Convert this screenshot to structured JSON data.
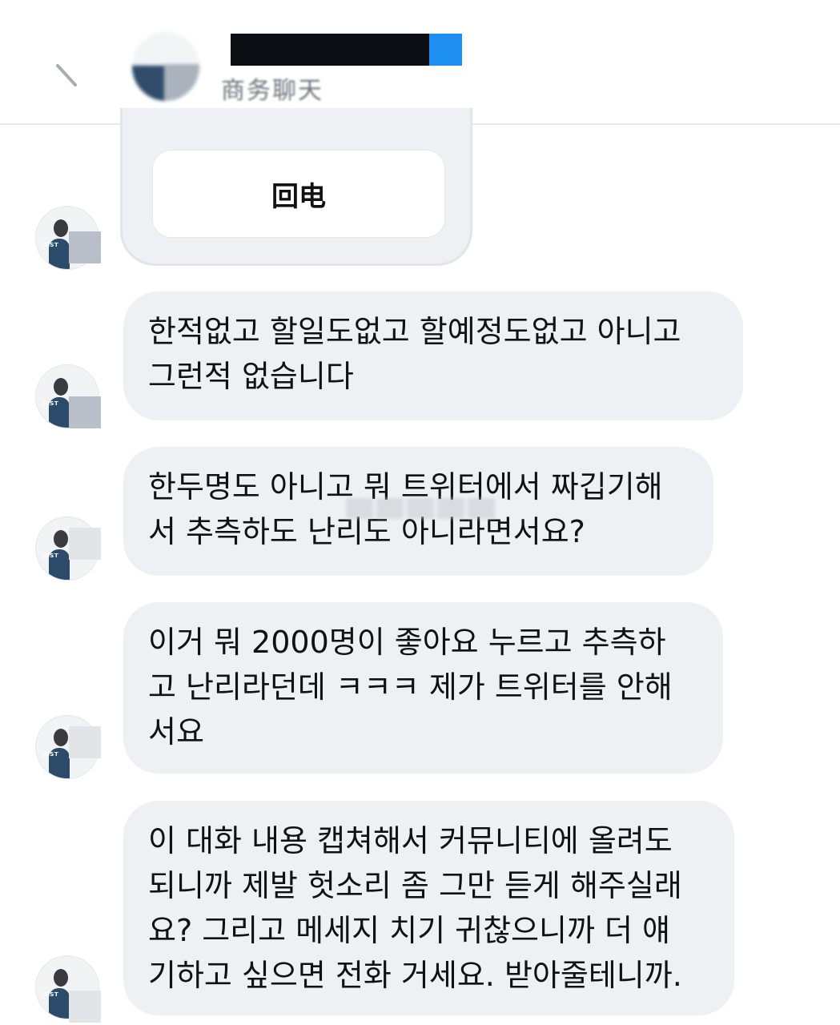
{
  "header": {
    "subtitle": "商务聊天",
    "back_icon": "chevron-left-icon"
  },
  "card": {
    "button_label": "回电"
  },
  "messages": [
    {
      "text": "한적없고 할일도없고 할예정도없고 아니고\n그런적 없습니다"
    },
    {
      "text": "한두명도 아니고 뭐 트위터에서 짜깁기해\n서 추측하도 난리도 아니라면서요?"
    },
    {
      "text": "이거 뭐 2000명이 좋아요 누르고 추측하\n고 난리라던데 ㅋㅋㅋ 제가 트위터를 안해\n서요"
    },
    {
      "text": "이 대화 내용 캡쳐해서 커뮤니티에 올려도\n되니까 제발 헛소리 좀 그만 듣게 해주실래\n요? 그리고 메세지 치기 귀찮으니까 더 얘\n기하고 싶으면 전화 거세요. 받아줄테니까."
    }
  ],
  "colors": {
    "bubble_bg": "#eef0f4",
    "redaction": "#0b0d12",
    "redaction_accent": "#1d8ff2",
    "subtitle_text": "#6f737a"
  }
}
